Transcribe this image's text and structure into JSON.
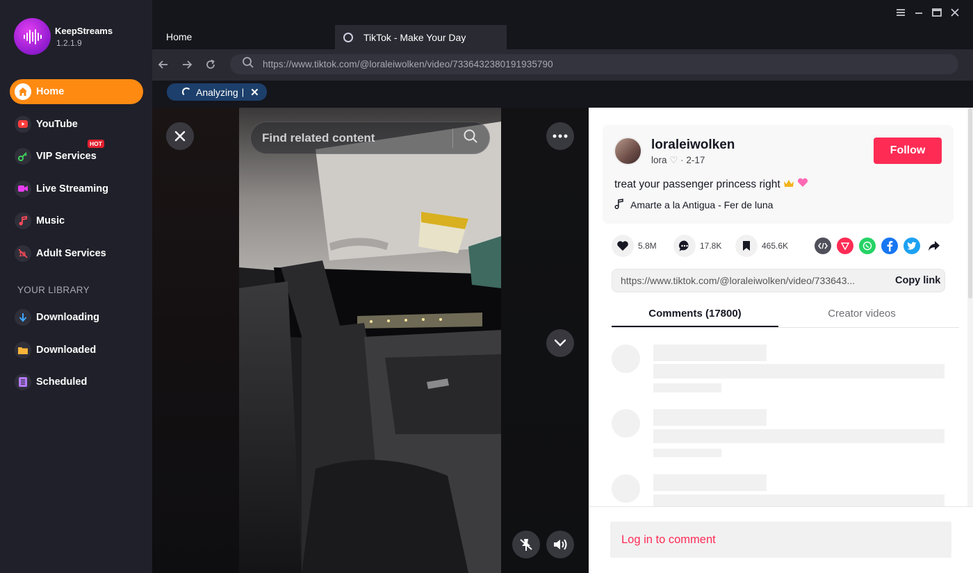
{
  "app": {
    "name": "KeepStreams",
    "version": "1.2.1.9"
  },
  "sidebar": {
    "items": [
      {
        "label": "Home",
        "icon": "home-icon",
        "active": true
      },
      {
        "label": "YouTube",
        "icon": "youtube-icon"
      },
      {
        "label": "VIP Services",
        "icon": "key-icon",
        "badge": "HOT"
      },
      {
        "label": "Live Streaming",
        "icon": "video-camera-icon"
      },
      {
        "label": "Music",
        "icon": "music-note-icon"
      },
      {
        "label": "Adult Services",
        "icon": "adult-restricted-icon"
      }
    ],
    "library_title": "YOUR LIBRARY",
    "library": [
      {
        "label": "Downloading",
        "icon": "download-arrow-icon"
      },
      {
        "label": "Downloaded",
        "icon": "folder-icon"
      },
      {
        "label": "Scheduled",
        "icon": "schedule-list-icon"
      }
    ]
  },
  "tabs": {
    "home": "Home",
    "tiktok": "TikTok - Make Your Day"
  },
  "address_bar": {
    "url": "https://www.tiktok.com/@loraleiwolken/video/7336432380191935790"
  },
  "analyze": {
    "label": "Analyzing",
    "separator": "|"
  },
  "video": {
    "search_placeholder": "Find related content"
  },
  "post": {
    "username": "loraleiwolken",
    "nickname": "lora",
    "date": "2-17",
    "follow_label": "Follow",
    "description": "treat your passenger princess right",
    "music": "Amarte a la Antigua - Fer de luna",
    "likes": "5.8M",
    "comments": "17.8K",
    "saves": "465.6K",
    "share_url": "https://www.tiktok.com/@loraleiwolken/video/733643...",
    "copy_label": "Copy link"
  },
  "panel_tabs": {
    "comments": "Comments (17800)",
    "creator": "Creator videos"
  },
  "login": {
    "label": "Log in to comment"
  },
  "colors": {
    "accent": "#ff8a12",
    "tiktok_red": "#fe2c55",
    "sidebar_bg": "#20202a"
  }
}
